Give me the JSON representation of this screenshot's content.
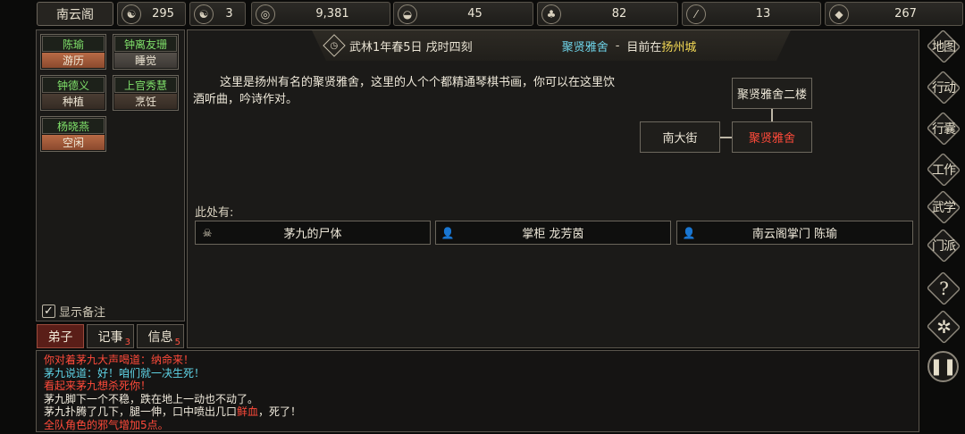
{
  "topbar": {
    "sect_name": "南云阁",
    "resources": [
      {
        "icon": "reputation-icon",
        "glyph": "☯",
        "value": "295"
      },
      {
        "icon": "yinyang-icon",
        "glyph": "☯",
        "value": "3"
      },
      {
        "icon": "coin-icon",
        "glyph": "◎",
        "value": "9,381"
      },
      {
        "icon": "food-bowl-icon",
        "glyph": "◒",
        "value": "45"
      },
      {
        "icon": "herb-icon",
        "glyph": "♣",
        "value": "82"
      },
      {
        "icon": "wood-icon",
        "glyph": "⁄",
        "value": "13"
      },
      {
        "icon": "ore-icon",
        "glyph": "◆",
        "value": "267"
      }
    ]
  },
  "disciples": [
    {
      "name": "陈瑜",
      "status": "游历"
    },
    {
      "name": "钟离友珊",
      "status": "睡觉"
    },
    {
      "name": "钟德义",
      "status": "种植"
    },
    {
      "name": "上官秀慧",
      "status": "烹饪"
    },
    {
      "name": "杨晓燕",
      "status": "空闲"
    }
  ],
  "show_note_label": "显示备注",
  "tabs": [
    {
      "label": "弟子",
      "badge": ""
    },
    {
      "label": "记事",
      "badge": "3"
    },
    {
      "label": "信息",
      "badge": "5"
    }
  ],
  "location": {
    "date": "武林1年春5日 戌时四刻",
    "place": "聚贤雅舍",
    "dash": "-",
    "now_prefix": "目前在",
    "city": "扬州城",
    "description": "这里是扬州有名的聚贤雅舍，这里的人个个都精通琴棋书画，你可以在这里饮酒听曲，吟诗作对。"
  },
  "map": {
    "north": "聚贤雅舍二楼",
    "west": "南大街",
    "current": "聚贤雅舍"
  },
  "here": {
    "label": "此处有:",
    "entities": [
      {
        "icon": "skull-icon",
        "label": "茅九的尸体"
      },
      {
        "icon": "person-icon",
        "label": "掌柜 龙芳茵"
      },
      {
        "icon": "person-icon",
        "label": "南云阁掌门 陈瑜"
      }
    ]
  },
  "log": [
    {
      "text": "你对着茅九大声喝道：纳命来！",
      "color": "red"
    },
    {
      "text": "茅九说道：好！咱们就一决生死！",
      "color": "cyan"
    },
    {
      "text": "看起来茅九想杀死你！",
      "color": "red"
    },
    {
      "text": "茅九脚下一个不稳，跌在地上一动也不动了。",
      "color": "white"
    },
    {
      "text_a": "茅九扑腾了几下，腿一伸，口中喷出几口",
      "text_b": "鲜血",
      "text_c": "，死了！",
      "color": "white"
    },
    {
      "text": "全队角色的邪气增加5点。",
      "color": "red"
    }
  ],
  "right_menu": [
    {
      "icon": "map-icon",
      "label": "地图"
    },
    {
      "icon": "action-icon",
      "label": "行动"
    },
    {
      "icon": "bag-icon",
      "label": "行囊"
    },
    {
      "icon": "work-icon",
      "label": "工作"
    },
    {
      "icon": "martial-icon",
      "label": "武学"
    },
    {
      "icon": "sect-icon",
      "label": "门派"
    }
  ]
}
